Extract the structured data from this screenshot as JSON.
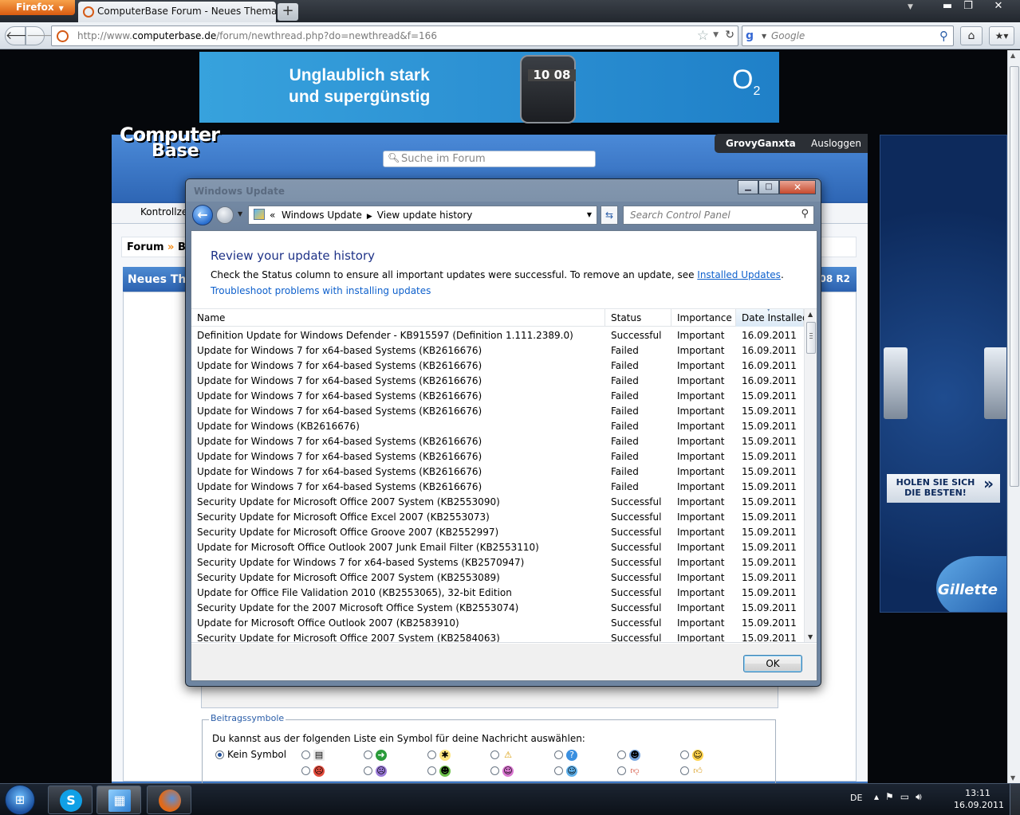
{
  "browser": {
    "app_button": "Firefox",
    "tab_title": "ComputerBase Forum - Neues Thema er...",
    "url_prefix": "http://www.",
    "url_domain": "computerbase.de",
    "url_path": "/forum/newthread.php?do=newthread&f=166",
    "search_engine": "Google"
  },
  "page": {
    "ad_top_line1": "Unglaublich stark",
    "ad_top_line2": "und supergünstig",
    "ad_top_clock": "10 08",
    "ad_top_brand": "O",
    "ad_top_brand_sub": "2",
    "logo_line1": "Computer",
    "logo_line2": "Base",
    "forum_search_placeholder": "Suche im Forum",
    "username": "GrovyGanxta",
    "logout": "Ausloggen",
    "subnav_item": "Kontrollze",
    "breadcrumb_forum": "Forum",
    "breadcrumb_sep": "»",
    "breadcrumb_next": "Bei",
    "thread_head": "Neues The",
    "thread_head_right": "08 R2",
    "symbols_legend": "Beitragssymbole",
    "symbols_desc": "Du kannst aus der folgenden Liste ein Symbol für deine Nachricht auswählen:",
    "symbols_none": "Kein Symbol",
    "ad_right_button_line1": "HOLEN SIE SICH",
    "ad_right_button_line2": "DIE BESTEN!",
    "ad_right_brand": "Gillette"
  },
  "dialog": {
    "faded_title": "Windows Update",
    "breadcrumb_prefix": "«",
    "breadcrumb_1": "Windows Update",
    "breadcrumb_2": "View update history",
    "search_placeholder": "Search Control Panel",
    "heading": "Review your update history",
    "description": "Check the Status column to ensure all important updates were successful. To remove an update, see ",
    "installed_link": "Installed Updates",
    "description_end": ".",
    "troubleshoot_link": "Troubleshoot problems with installing updates",
    "columns": {
      "name": "Name",
      "status": "Status",
      "importance": "Importance",
      "date": "Date Installed"
    },
    "rows": [
      {
        "name": "Definition Update for Windows Defender - KB915597 (Definition 1.111.2389.0)",
        "status": "Successful",
        "importance": "Important",
        "date": "16.09.2011"
      },
      {
        "name": "Update for Windows 7 for x64-based Systems (KB2616676)",
        "status": "Failed",
        "importance": "Important",
        "date": "16.09.2011"
      },
      {
        "name": "Update for Windows 7 for x64-based Systems (KB2616676)",
        "status": "Failed",
        "importance": "Important",
        "date": "16.09.2011"
      },
      {
        "name": "Update for Windows 7 for x64-based Systems (KB2616676)",
        "status": "Failed",
        "importance": "Important",
        "date": "16.09.2011"
      },
      {
        "name": "Update for Windows 7 for x64-based Systems (KB2616676)",
        "status": "Failed",
        "importance": "Important",
        "date": "15.09.2011"
      },
      {
        "name": "Update for Windows 7 for x64-based Systems (KB2616676)",
        "status": "Failed",
        "importance": "Important",
        "date": "15.09.2011"
      },
      {
        "name": "Update for Windows (KB2616676)",
        "status": "Failed",
        "importance": "Important",
        "date": "15.09.2011"
      },
      {
        "name": "Update for Windows 7 for x64-based Systems (KB2616676)",
        "status": "Failed",
        "importance": "Important",
        "date": "15.09.2011"
      },
      {
        "name": "Update for Windows 7 for x64-based Systems (KB2616676)",
        "status": "Failed",
        "importance": "Important",
        "date": "15.09.2011"
      },
      {
        "name": "Update for Windows 7 for x64-based Systems (KB2616676)",
        "status": "Failed",
        "importance": "Important",
        "date": "15.09.2011"
      },
      {
        "name": "Update for Windows 7 for x64-based Systems (KB2616676)",
        "status": "Failed",
        "importance": "Important",
        "date": "15.09.2011"
      },
      {
        "name": "Security Update for Microsoft Office 2007 System (KB2553090)",
        "status": "Successful",
        "importance": "Important",
        "date": "15.09.2011"
      },
      {
        "name": "Security Update for Microsoft Office Excel 2007 (KB2553073)",
        "status": "Successful",
        "importance": "Important",
        "date": "15.09.2011"
      },
      {
        "name": "Security Update for Microsoft Office Groove 2007 (KB2552997)",
        "status": "Successful",
        "importance": "Important",
        "date": "15.09.2011"
      },
      {
        "name": "Update for Microsoft Office Outlook 2007 Junk Email Filter (KB2553110)",
        "status": "Successful",
        "importance": "Important",
        "date": "15.09.2011"
      },
      {
        "name": "Security Update for Windows 7 for x64-based Systems (KB2570947)",
        "status": "Successful",
        "importance": "Important",
        "date": "15.09.2011"
      },
      {
        "name": "Security Update for Microsoft Office 2007 System (KB2553089)",
        "status": "Successful",
        "importance": "Important",
        "date": "15.09.2011"
      },
      {
        "name": "Update for Office File Validation 2010 (KB2553065), 32-bit Edition",
        "status": "Successful",
        "importance": "Important",
        "date": "15.09.2011"
      },
      {
        "name": "Security Update for the 2007 Microsoft Office System (KB2553074)",
        "status": "Successful",
        "importance": "Important",
        "date": "15.09.2011"
      },
      {
        "name": "Update for Microsoft Office Outlook 2007 (KB2583910)",
        "status": "Successful",
        "importance": "Important",
        "date": "15.09.2011"
      },
      {
        "name": "Security Update for Microsoft Office 2007 System (KB2584063)",
        "status": "Successful",
        "importance": "Important",
        "date": "15.09.2011"
      }
    ],
    "ok_label": "OK"
  },
  "taskbar": {
    "language": "DE",
    "time": "13:11",
    "date": "16.09.2011"
  },
  "icons": {
    "back": "back-arrow-icon",
    "forward": "forward-arrow-icon",
    "bookmark": "star-icon",
    "reload": "reload-icon",
    "home": "home-icon",
    "search": "magnifier-icon"
  }
}
